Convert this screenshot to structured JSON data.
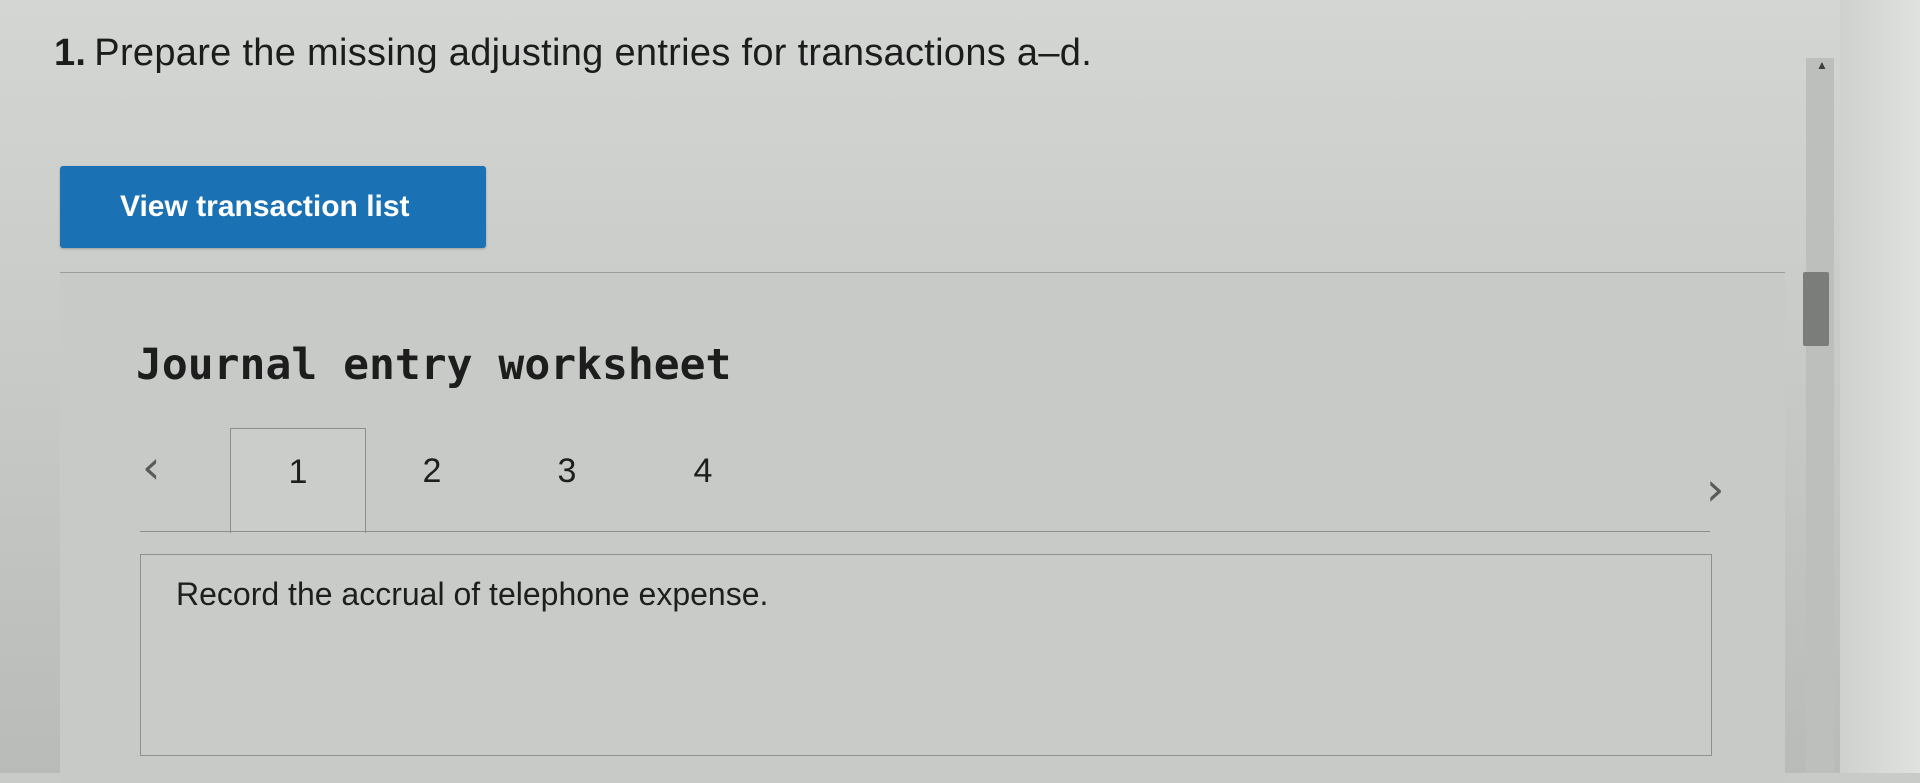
{
  "question": {
    "number": "1.",
    "text": "Prepare the missing adjusting entries for transactions a–d."
  },
  "actions": {
    "view_transaction_list": "View transaction list"
  },
  "worksheet": {
    "title": "Journal entry worksheet",
    "prev_icon": "chevron-left-icon",
    "next_icon": "chevron-right-icon",
    "tabs": [
      "1",
      "2",
      "3",
      "4"
    ],
    "active_tab": "1",
    "instruction": "Record the accrual of telephone expense."
  },
  "colors": {
    "primary_button": "#1a72b5",
    "background": "#c9cbc9"
  }
}
